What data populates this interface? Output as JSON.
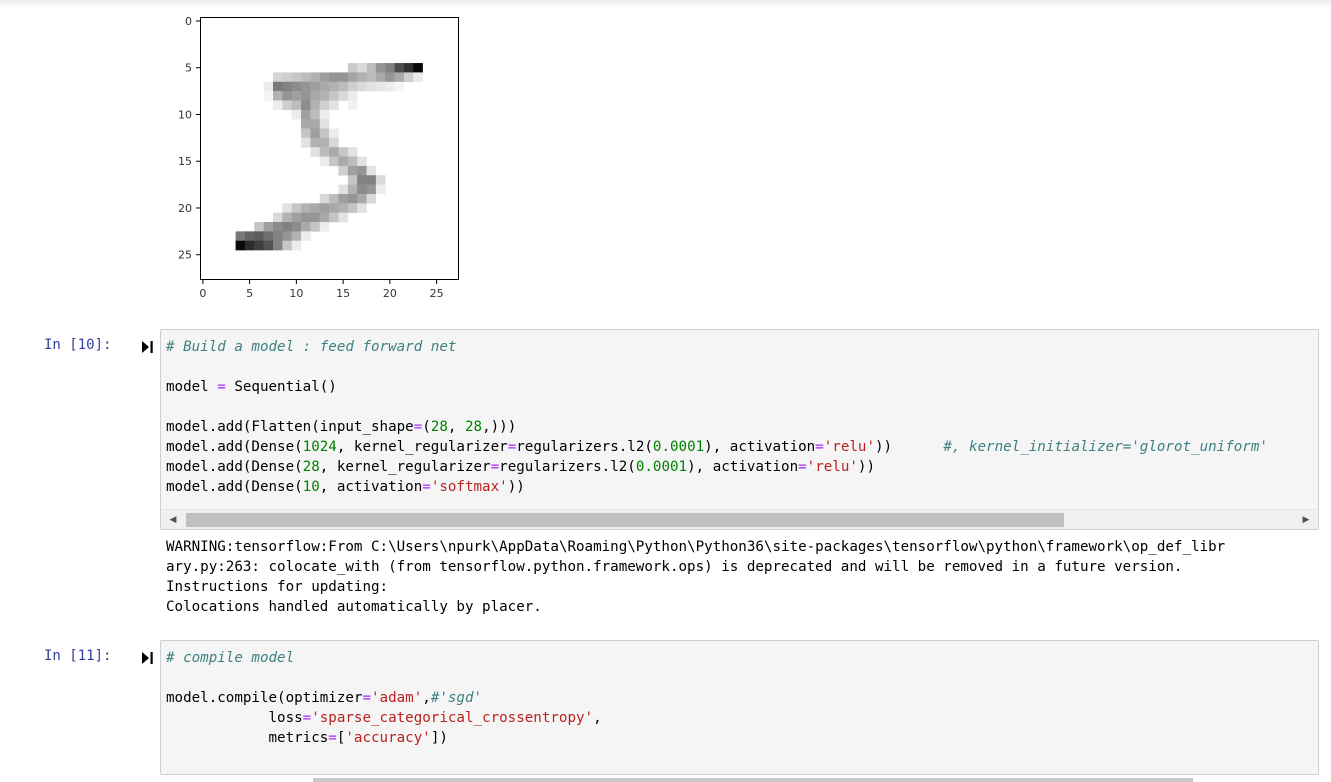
{
  "figure": {
    "x_ticks": [
      "0",
      "5",
      "10",
      "15",
      "20",
      "25"
    ],
    "y_ticks": [
      "0",
      "5",
      "10",
      "15",
      "20",
      "25"
    ],
    "image_size": 28,
    "nonzero_pixels": [
      [
        5,
        20,
        130
      ],
      [
        5,
        21,
        185
      ],
      [
        5,
        22,
        215
      ],
      [
        5,
        23,
        255
      ],
      [
        5,
        18,
        70
      ],
      [
        5,
        19,
        110
      ],
      [
        5,
        16,
        55
      ],
      [
        5,
        17,
        40
      ],
      [
        6,
        8,
        45
      ],
      [
        6,
        9,
        50
      ],
      [
        6,
        10,
        60
      ],
      [
        6,
        11,
        70
      ],
      [
        6,
        12,
        80
      ],
      [
        6,
        13,
        100
      ],
      [
        6,
        14,
        110
      ],
      [
        6,
        15,
        110
      ],
      [
        6,
        16,
        95
      ],
      [
        6,
        17,
        80
      ],
      [
        6,
        18,
        70
      ],
      [
        6,
        19,
        90
      ],
      [
        6,
        20,
        110
      ],
      [
        6,
        21,
        90
      ],
      [
        6,
        22,
        50
      ],
      [
        6,
        23,
        20
      ],
      [
        7,
        7,
        20
      ],
      [
        7,
        8,
        140
      ],
      [
        7,
        9,
        130
      ],
      [
        7,
        10,
        120
      ],
      [
        7,
        11,
        110
      ],
      [
        7,
        12,
        100
      ],
      [
        7,
        13,
        90
      ],
      [
        7,
        14,
        80
      ],
      [
        7,
        15,
        70
      ],
      [
        7,
        16,
        50
      ],
      [
        7,
        17,
        40
      ],
      [
        7,
        18,
        30
      ],
      [
        7,
        19,
        25
      ],
      [
        7,
        20,
        20
      ],
      [
        7,
        21,
        10
      ],
      [
        8,
        7,
        10
      ],
      [
        8,
        8,
        80
      ],
      [
        8,
        9,
        110
      ],
      [
        8,
        10,
        100
      ],
      [
        8,
        11,
        110
      ],
      [
        8,
        12,
        90
      ],
      [
        8,
        13,
        80
      ],
      [
        8,
        14,
        60
      ],
      [
        8,
        15,
        40
      ],
      [
        8,
        16,
        20
      ],
      [
        9,
        8,
        20
      ],
      [
        9,
        9,
        50
      ],
      [
        9,
        10,
        70
      ],
      [
        9,
        11,
        120
      ],
      [
        9,
        12,
        80
      ],
      [
        9,
        13,
        50
      ],
      [
        9,
        14,
        30
      ],
      [
        9,
        16,
        15
      ],
      [
        10,
        10,
        20
      ],
      [
        10,
        11,
        100
      ],
      [
        10,
        12,
        70
      ],
      [
        10,
        13,
        20
      ],
      [
        11,
        11,
        90
      ],
      [
        11,
        12,
        90
      ],
      [
        11,
        13,
        30
      ],
      [
        12,
        11,
        60
      ],
      [
        12,
        12,
        100
      ],
      [
        12,
        13,
        60
      ],
      [
        12,
        14,
        20
      ],
      [
        13,
        11,
        30
      ],
      [
        13,
        12,
        80
      ],
      [
        13,
        13,
        80
      ],
      [
        13,
        14,
        40
      ],
      [
        14,
        12,
        30
      ],
      [
        14,
        13,
        70
      ],
      [
        14,
        14,
        90
      ],
      [
        14,
        15,
        60
      ],
      [
        14,
        16,
        30
      ],
      [
        15,
        13,
        20
      ],
      [
        15,
        14,
        60
      ],
      [
        15,
        15,
        90
      ],
      [
        15,
        16,
        70
      ],
      [
        15,
        17,
        30
      ],
      [
        16,
        15,
        50
      ],
      [
        16,
        16,
        100
      ],
      [
        16,
        17,
        110
      ],
      [
        16,
        18,
        30
      ],
      [
        17,
        16,
        60
      ],
      [
        17,
        17,
        130
      ],
      [
        17,
        18,
        130
      ],
      [
        17,
        19,
        40
      ],
      [
        18,
        15,
        30
      ],
      [
        18,
        16,
        80
      ],
      [
        18,
        17,
        120
      ],
      [
        18,
        18,
        110
      ],
      [
        18,
        19,
        20
      ],
      [
        19,
        13,
        40
      ],
      [
        19,
        14,
        70
      ],
      [
        19,
        15,
        100
      ],
      [
        19,
        16,
        110
      ],
      [
        19,
        17,
        90
      ],
      [
        19,
        18,
        40
      ],
      [
        20,
        9,
        30
      ],
      [
        20,
        10,
        60
      ],
      [
        20,
        11,
        80
      ],
      [
        20,
        12,
        90
      ],
      [
        20,
        13,
        100
      ],
      [
        20,
        14,
        90
      ],
      [
        20,
        15,
        80
      ],
      [
        20,
        16,
        60
      ],
      [
        20,
        17,
        30
      ],
      [
        21,
        8,
        40
      ],
      [
        21,
        9,
        80
      ],
      [
        21,
        10,
        100
      ],
      [
        21,
        11,
        110
      ],
      [
        21,
        12,
        110
      ],
      [
        21,
        13,
        90
      ],
      [
        21,
        14,
        60
      ],
      [
        21,
        15,
        30
      ],
      [
        22,
        6,
        60
      ],
      [
        22,
        7,
        100
      ],
      [
        22,
        8,
        120
      ],
      [
        22,
        9,
        130
      ],
      [
        22,
        10,
        120
      ],
      [
        22,
        11,
        90
      ],
      [
        22,
        12,
        60
      ],
      [
        22,
        13,
        20
      ],
      [
        23,
        4,
        140
      ],
      [
        23,
        5,
        160
      ],
      [
        23,
        6,
        170
      ],
      [
        23,
        7,
        150
      ],
      [
        23,
        8,
        130
      ],
      [
        23,
        9,
        110
      ],
      [
        23,
        10,
        80
      ],
      [
        23,
        11,
        20
      ],
      [
        24,
        4,
        255
      ],
      [
        24,
        5,
        220
      ],
      [
        24,
        6,
        200
      ],
      [
        24,
        7,
        180
      ],
      [
        24,
        8,
        130
      ],
      [
        24,
        9,
        60
      ],
      [
        24,
        10,
        20
      ]
    ]
  },
  "cell10": {
    "prompt": "In [10]:",
    "code": [
      [
        [
          "cm",
          "# Build a model : feed forward net"
        ]
      ],
      [],
      [
        [
          "",
          "model "
        ],
        [
          "op",
          "="
        ],
        [
          "",
          " Sequential()"
        ]
      ],
      [],
      [
        [
          "",
          "model.add(Flatten(input_shape"
        ],
        [
          "op",
          "="
        ],
        [
          "",
          "("
        ],
        [
          "num",
          "28"
        ],
        [
          "",
          ", "
        ],
        [
          "num",
          "28"
        ],
        [
          "",
          ",)))"
        ]
      ],
      [
        [
          "",
          "model.add(Dense("
        ],
        [
          "num",
          "1024"
        ],
        [
          "",
          ", kernel_regularizer"
        ],
        [
          "op",
          "="
        ],
        [
          "",
          "regularizers.l2("
        ],
        [
          "num",
          "0.0001"
        ],
        [
          "",
          "), activation"
        ],
        [
          "op",
          "="
        ],
        [
          "str",
          "'relu'"
        ],
        [
          "",
          "))      "
        ],
        [
          "cm",
          "#, kernel_initializer='glorot_uniform'"
        ]
      ],
      [
        [
          "",
          "model.add(Dense("
        ],
        [
          "num",
          "28"
        ],
        [
          "",
          ", kernel_regularizer"
        ],
        [
          "op",
          "="
        ],
        [
          "",
          "regularizers.l2("
        ],
        [
          "num",
          "0.0001"
        ],
        [
          "",
          "), activation"
        ],
        [
          "op",
          "="
        ],
        [
          "str",
          "'relu'"
        ],
        [
          "",
          "))"
        ]
      ],
      [
        [
          "",
          "model.add(Dense("
        ],
        [
          "num",
          "10"
        ],
        [
          "",
          ", activation"
        ],
        [
          "op",
          "="
        ],
        [
          "str",
          "'softmax'"
        ],
        [
          "",
          "))"
        ]
      ]
    ],
    "output": [
      "WARNING:tensorflow:From C:\\Users\\npurk\\AppData\\Roaming\\Python\\Python36\\site-packages\\tensorflow\\python\\framework\\op_def_libr",
      "ary.py:263: colocate_with (from tensorflow.python.framework.ops) is deprecated and will be removed in a future version.",
      "Instructions for updating:",
      "Colocations handled automatically by placer."
    ]
  },
  "cell11": {
    "prompt": "In [11]:",
    "code": [
      [
        [
          "cm",
          "# compile model"
        ]
      ],
      [],
      [
        [
          "",
          "model.compile(optimizer"
        ],
        [
          "op",
          "="
        ],
        [
          "str",
          "'adam'"
        ],
        [
          "",
          ","
        ],
        [
          "cm",
          "#'sgd'"
        ]
      ],
      [
        [
          "",
          "            loss"
        ],
        [
          "op",
          "="
        ],
        [
          "str",
          "'sparse_categorical_crossentropy'"
        ],
        [
          "",
          ","
        ]
      ],
      [
        [
          "",
          "            metrics"
        ],
        [
          "op",
          "="
        ],
        [
          "",
          "["
        ],
        [
          "str",
          "'accuracy'"
        ],
        [
          "",
          "])"
        ]
      ]
    ]
  },
  "icons": {
    "run": "run-cell-icon",
    "scroll_left": "scroll-left-arrow-icon",
    "scroll_right": "scroll-right-arrow-icon"
  },
  "colors": {
    "prompt": "#303f9f",
    "comment": "#408080",
    "operator": "#aa22ff",
    "number": "#008000",
    "string": "#ba2121",
    "cell_bg": "#f5f5f5"
  }
}
